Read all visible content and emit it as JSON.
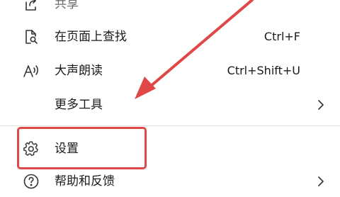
{
  "menu": {
    "items": [
      {
        "label": "共享",
        "shortcut": "",
        "icon": "share-icon"
      },
      {
        "label": "在页面上查找",
        "shortcut": "Ctrl+F",
        "icon": "find-on-page-icon"
      },
      {
        "label": "大声朗读",
        "shortcut": "Ctrl+Shift+U",
        "icon": "read-aloud-icon"
      },
      {
        "label": "更多工具",
        "shortcut": "",
        "icon": "chevron-right-icon"
      },
      {
        "label": "设置",
        "shortcut": "",
        "icon": "gear-icon"
      },
      {
        "label": "帮助和反馈",
        "shortcut": "",
        "icon": "help-icon"
      }
    ]
  },
  "annotation": {
    "color": "#e04848"
  }
}
